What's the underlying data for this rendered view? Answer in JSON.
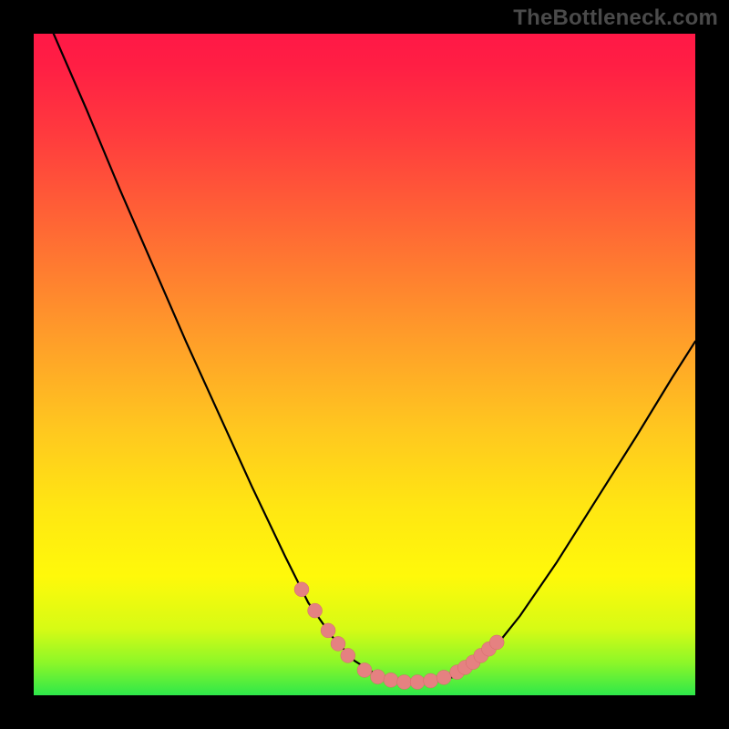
{
  "watermark": "TheBottleneck.com",
  "colors": {
    "page_bg": "#000000",
    "gradient_top": "#ff1846",
    "gradient_mid": "#ffe712",
    "gradient_bottom": "#2ee84a",
    "curve": "#000000",
    "marker": "#e58181"
  },
  "chart_data": {
    "type": "line",
    "title": "",
    "xlabel": "",
    "ylabel": "",
    "xlim": [
      0,
      1
    ],
    "ylim": [
      0,
      1
    ],
    "notes": "No axes, ticks, or labels are rendered. Values are normalized to the plot area (0–1). y is normalized top→bottom, so larger y is lower on screen. The curve is a V-shaped profile: steep descent from top-left, a flat minimum near x≈0.50–0.62, then a moderate rise to the right edge. Salmon circular markers cluster on the descending arm near the bottom, across the flat minimum, and on the initial ascending arm.",
    "series": [
      {
        "name": "curve",
        "x": [
          0.03,
          0.08,
          0.13,
          0.18,
          0.23,
          0.28,
          0.33,
          0.38,
          0.415,
          0.45,
          0.485,
          0.515,
          0.545,
          0.575,
          0.605,
          0.635,
          0.665,
          0.695,
          0.735,
          0.79,
          0.85,
          0.91,
          0.965,
          1.0
        ],
        "y": [
          0.0,
          0.115,
          0.235,
          0.35,
          0.465,
          0.575,
          0.685,
          0.79,
          0.86,
          0.91,
          0.948,
          0.967,
          0.977,
          0.981,
          0.98,
          0.972,
          0.955,
          0.93,
          0.88,
          0.8,
          0.705,
          0.61,
          0.52,
          0.465
        ]
      },
      {
        "name": "markers-left-arm",
        "x": [
          0.405,
          0.425,
          0.445,
          0.46,
          0.475
        ],
        "y": [
          0.84,
          0.872,
          0.902,
          0.922,
          0.94
        ]
      },
      {
        "name": "markers-bottom",
        "x": [
          0.5,
          0.52,
          0.54,
          0.56,
          0.58,
          0.6,
          0.62
        ],
        "y": [
          0.962,
          0.972,
          0.977,
          0.98,
          0.98,
          0.978,
          0.973
        ]
      },
      {
        "name": "markers-right-arm",
        "x": [
          0.64,
          0.652,
          0.664,
          0.676,
          0.688,
          0.7
        ],
        "y": [
          0.965,
          0.958,
          0.95,
          0.94,
          0.93,
          0.92
        ]
      }
    ]
  }
}
